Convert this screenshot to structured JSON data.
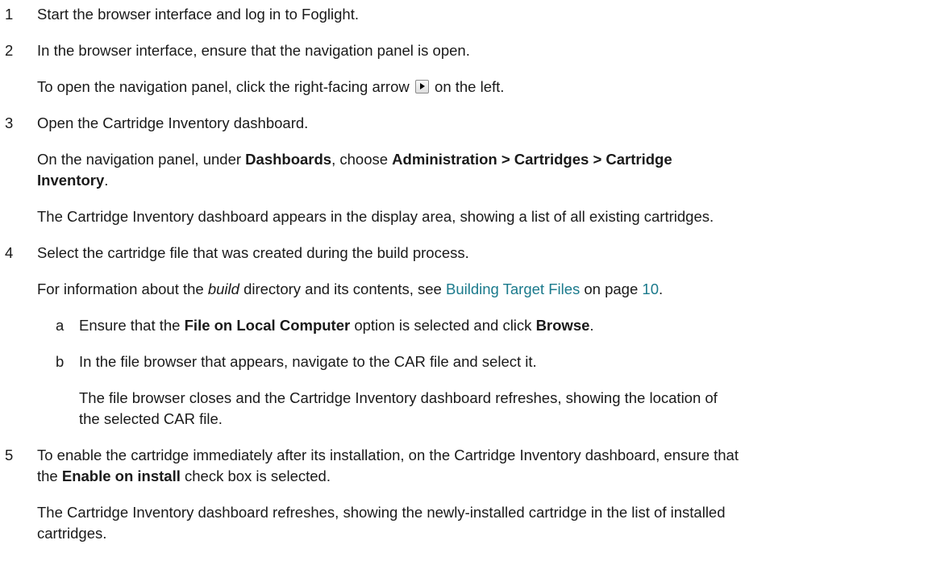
{
  "steps": [
    {
      "number": "1",
      "text": "Start the browser interface and log in to Foglight."
    },
    {
      "number": "2",
      "text": "In the browser interface, ensure that the navigation panel is open.",
      "detail_before": "To open the navigation panel, click the right-facing arrow",
      "detail_after": "on the left."
    },
    {
      "number": "3",
      "text": "Open the Cartridge Inventory dashboard.",
      "nav_pre": "On the navigation panel, under",
      "nav_dashboards": "Dashboards",
      "nav_mid": ", choose",
      "nav_path_1": "Administration > Cartridges > Cartridge",
      "nav_path_2": "Inventory",
      "nav_end": ".",
      "result": "The Cartridge Inventory dashboard appears in the display area, showing a list of all existing cartridges."
    },
    {
      "number": "4",
      "text": "Select the cartridge file that was created during the build process.",
      "info_pre": "For information about the",
      "info_build": "build",
      "info_mid": "directory and its contents, see",
      "info_link": "Building Target Files",
      "info_on_page": "on page",
      "info_page": "10",
      "info_end": ".",
      "substeps": [
        {
          "letter": "a",
          "pre": "Ensure that the",
          "bold1": "File on Local Computer",
          "mid": "option is selected and click",
          "bold2": "Browse",
          "end": "."
        },
        {
          "letter": "b",
          "text": "In the file browser that appears, navigate to the CAR file and select it.",
          "result_1": "The file browser closes and the Cartridge Inventory dashboard refreshes, showing the location of",
          "result_2": "the selected CAR file."
        }
      ]
    },
    {
      "number": "5",
      "text_1": "To enable the cartridge immediately after its installation, on the Cartridge Inventory dashboard, ensure that",
      "text_2_pre": "the",
      "text_2_bold": "Enable on install",
      "text_2_post": "check box is selected.",
      "result_1": "The Cartridge Inventory dashboard refreshes, showing the newly-installed cartridge in the list of installed",
      "result_2": "cartridges."
    }
  ],
  "colors": {
    "link": "#1b7a8c",
    "text": "#1a1a1a"
  },
  "icons": {
    "arrow": "right-facing-arrow-icon"
  }
}
